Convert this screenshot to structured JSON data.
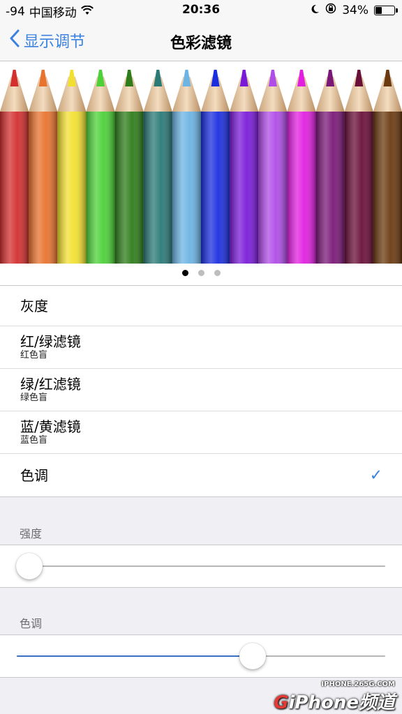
{
  "status_bar": {
    "signal": "-94",
    "carrier": "中国移动",
    "time": "20:36",
    "battery": "34%",
    "battery_level": 0.34
  },
  "nav": {
    "back_label": "显示调节",
    "title": "色彩滤镜"
  },
  "hero": {
    "pencil_colors": [
      "#d32f2f",
      "#e8732e",
      "#f2e030",
      "#4cd138",
      "#2e7d1a",
      "#2a7a78",
      "#6cb4e4",
      "#1a2ee0",
      "#7a1ad8",
      "#b04ce8",
      "#e21fe0",
      "#7a1877",
      "#6a0f38",
      "#6b3a10"
    ],
    "page_count": 3,
    "active_page": 0
  },
  "filters": [
    {
      "title": "灰度",
      "subtitle": "",
      "selected": false
    },
    {
      "title": "红/绿滤镜",
      "subtitle": "红色盲",
      "selected": false
    },
    {
      "title": "绿/红滤镜",
      "subtitle": "绿色盲",
      "selected": false
    },
    {
      "title": "蓝/黄滤镜",
      "subtitle": "蓝色盲",
      "selected": false
    },
    {
      "title": "色调",
      "subtitle": "",
      "selected": true
    }
  ],
  "checkmark": "✓",
  "intensity": {
    "header": "强度",
    "value": 0.0
  },
  "hue": {
    "header": "色调",
    "value": 0.64
  },
  "watermark": {
    "url": "IPHONE.265G.COM",
    "brand_g": "G",
    "brand_rest": "iPhone频道"
  },
  "colors": {
    "accent": "#3b82e0",
    "slider_fill": "#3b6fc2"
  }
}
